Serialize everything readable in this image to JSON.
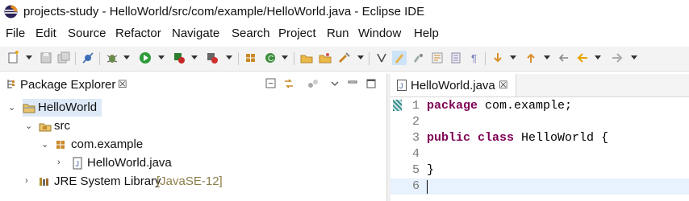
{
  "window": {
    "title": "projects-study - HelloWorld/src/com/example/HelloWorld.java - Eclipse IDE",
    "icon": "eclipse-logo-icon"
  },
  "menu": [
    "File",
    "Edit",
    "Source",
    "Refactor",
    "Navigate",
    "Search",
    "Project",
    "Run",
    "Window",
    "Help"
  ],
  "toolbar": {
    "icons": [
      "new-icon",
      "save-icon",
      "save-all-icon",
      "skip-breakpoints-icon",
      "debug-icon",
      "run-icon",
      "coverage-icon",
      "external-tools-icon",
      "new-java-package-icon",
      "new-java-class-icon",
      "open-type-icon",
      "open-task-icon",
      "search-icon",
      "toggle-ant-editor-icon",
      "mark-occurrences-icon",
      "toggle-breadcrumb-icon",
      "block-selection-icon",
      "show-whitespace-icon",
      "next-annotation-icon",
      "previous-annotation-icon",
      "last-edit-location-icon",
      "back-icon",
      "forward-icon"
    ]
  },
  "package_explorer": {
    "title": "Package Explorer",
    "close": "☒",
    "tree": {
      "project": "HelloWorld",
      "src": "src",
      "package": "com.example",
      "file": "HelloWorld.java",
      "library": "JRE System Library",
      "library_decoration": "[JavaSE-12]"
    }
  },
  "editor": {
    "tab_label": "HelloWorld.java",
    "close": "☒",
    "line_numbers": [
      "1",
      "2",
      "3",
      "4",
      "5",
      "6"
    ],
    "lines": {
      "l1_kw": "package",
      "l1_rest": " com.example;",
      "l3_kw1": "public",
      "l3_kw2": "class",
      "l3_rest": " HelloWorld {",
      "l5": "}"
    },
    "current_line": 6
  },
  "colors": {
    "keyword": "#7f0055",
    "selection": "#dde9f6",
    "current_line": "#e8f2fe",
    "decoration": "#8b7d48"
  }
}
